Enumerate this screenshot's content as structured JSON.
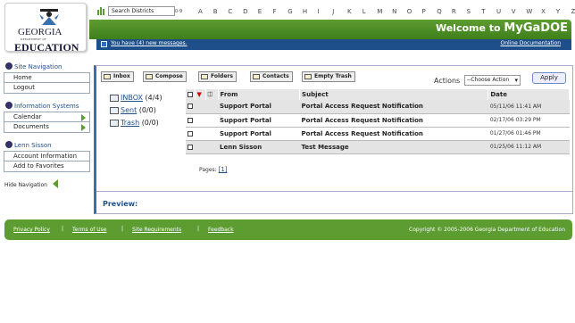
{
  "header": {
    "logo": {
      "line1": "GEORGIA",
      "line2": "DEPARTMENT OF",
      "line3": "EDUCATION"
    },
    "search_placeholder": "Search Districts",
    "alpha_prefix": "0-9",
    "letters": [
      "A",
      "B",
      "C",
      "D",
      "E",
      "F",
      "G",
      "H",
      "I",
      "J",
      "K",
      "L",
      "M",
      "N",
      "O",
      "P",
      "Q",
      "R",
      "S",
      "T",
      "U",
      "V",
      "W",
      "X",
      "Y",
      "Z"
    ],
    "welcome_prefix": "Welcome to ",
    "welcome_brand": "MyGaDOE",
    "messages_link": "You have (4) new messages.",
    "docs_link": "Online Documentation"
  },
  "sidebar": {
    "site_nav_title": "Site Navigation",
    "site_nav_items": [
      "Home",
      "Logout"
    ],
    "info_title": "Information Systems",
    "info_items": [
      "Calendar",
      "Documents"
    ],
    "user_title": "Lenn Sisson",
    "user_items": [
      "Account Information",
      "Add to Favorites"
    ],
    "hide_nav": "Hide Navigation"
  },
  "toolbar": {
    "inbox": "Inbox",
    "compose": "Compose",
    "folders": "Folders",
    "contacts": "Contacts",
    "empty_trash": "Empty Trash",
    "actions_label": "Actions",
    "actions_value": "--Choose Action",
    "apply": "Apply"
  },
  "folders": [
    {
      "name": "INBOX",
      "count": "(4/4)"
    },
    {
      "name": "Sent",
      "count": "(0/0)"
    },
    {
      "name": "Trash",
      "count": "(0/0)"
    }
  ],
  "table": {
    "headers": {
      "from": "From",
      "subject": "Subject",
      "date": "Date"
    },
    "rows": [
      {
        "from": "Support Portal",
        "subject": "Portal Access Request Notification",
        "date": "05/11/06 11:41 AM"
      },
      {
        "from": "Support Portal",
        "subject": "Portal Access Request Notification",
        "date": "02/17/06 03:29 PM"
      },
      {
        "from": "Support Portal",
        "subject": "Portal Access Request Notification",
        "date": "01/27/06 01:46 PM"
      },
      {
        "from": "Lenn Sisson",
        "subject": "Test Message",
        "date": "01/25/06 11:12 AM"
      }
    ],
    "pages_label": "Pages:",
    "page_1": "[1]"
  },
  "preview_label": "Preview:",
  "footer": {
    "links": [
      "Privacy Policy",
      "Terms of Use",
      "Site Requirements",
      "Feedback"
    ],
    "copyright": "Copyright © 2005-2006 Georgia Department of Education"
  }
}
